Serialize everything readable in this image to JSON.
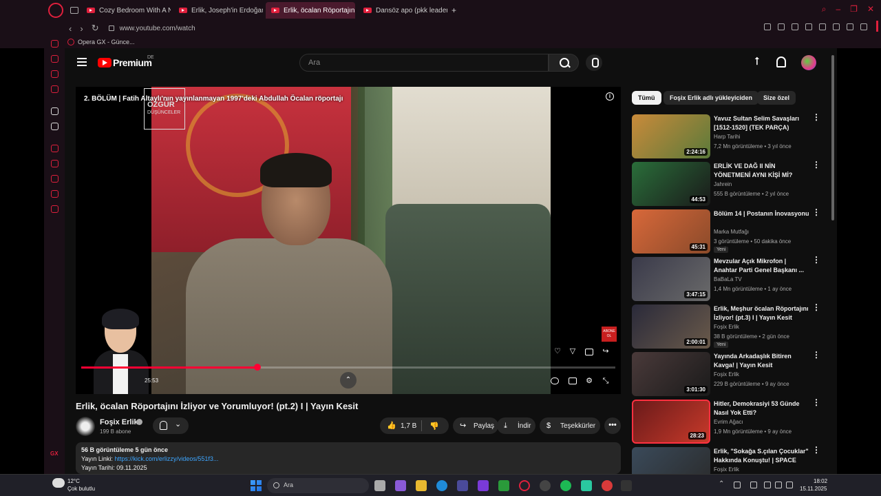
{
  "browser": {
    "tabs": [
      {
        "label": "Cozy Bedroom With A Ni",
        "active": false
      },
      {
        "label": "Erlik, Joseph'in Erdoğan",
        "active": false
      },
      {
        "label": "Erlik, öcalan Röportajını İz",
        "active": true
      },
      {
        "label": "Dansöz apo (pkk leader a",
        "active": false
      }
    ],
    "new_tab_label": "+",
    "url": "www.youtube.com/watch",
    "bookmark": "Opera GX - Günce...",
    "sidebar_gx": "GX",
    "accent": "#e0203d"
  },
  "youtube": {
    "logo_text": "Premium",
    "logo_region": "DE",
    "search_placeholder": "Ara",
    "upload_icon_glyph": "⭡"
  },
  "player": {
    "overlay_title": "2. BÖLÜM | Fatih Altaylı'nın yayınlanmayan 1997'deki Abdullah Öcalan röportajı",
    "channel_logo_line1": "ÖZGÜR",
    "channel_logo_line2": "DÜŞÜNCELER",
    "abone_badge": "ABONE OL",
    "time": "25:53",
    "progress": 0.33,
    "expand_glyph": "⌃",
    "info_glyph": "i"
  },
  "video": {
    "title": "Erlik, öcalan Röportajını İzliyor ve Yorumluyor! (pt.2) I | Yayın Kesit",
    "channel": "Foşix Erlik",
    "subscribers": "199 B abone",
    "likes": "1,7 B",
    "share_label": "Paylaş",
    "download_label": "İndir",
    "thanks_label": "Teşekkürler",
    "more_glyph": "•••",
    "bell_chevron": "⌄",
    "like_glyph": "👍",
    "dislike_glyph": "👎",
    "share_glyph": "↪",
    "download_glyph": "⤓",
    "thanks_glyph": "$"
  },
  "description": {
    "stats": "56 B görüntüleme  5 gün önce",
    "link_prefix": "Yayın Linki: ",
    "link": "https://kick.com/erlizzy/videos/551f3...",
    "date_line": "Yayın Tarihi: 09.11.2025"
  },
  "chips": [
    "Tümü",
    "Foşix Erlik adlı yükleyiciden",
    "Size özel"
  ],
  "recommendations": [
    {
      "title": "Yavuz Sultan Selim Savaşları [1512-1520] (TEK PARÇA)",
      "channel": "Harp Tarihi",
      "meta": "7,2 Mn görüntüleme • 3 yıl önce",
      "duration": "2:24:16",
      "badge": "",
      "thumb_color": "#c98a3a",
      "thumb_color2": "#5a7a3a"
    },
    {
      "title": "ERLİK VE DAĞ II NİN YÖNETMENİ AYNI KİŞİ Mİ?",
      "channel": "Jahrein",
      "meta": "555 B görüntüleme • 2 yıl önce",
      "duration": "44:53",
      "badge": "",
      "thumb_color": "#2a6e3a",
      "thumb_color2": "#1a1a1a"
    },
    {
      "title": "Bölüm 14 | Postanın İnovasyonu",
      "channel": "Marka Mutfağı",
      "meta": "3 görüntüleme • 50 dakika önce",
      "duration": "45:31",
      "badge": "Yeni",
      "thumb_color": "#d8683a",
      "thumb_color2": "#8a4a2a"
    },
    {
      "title": "Mevzular Açık Mikrofon | Anahtar Parti Genel Başkanı ...",
      "channel": "BaBaLa TV",
      "meta": "1,4 Mn görüntüleme • 1 ay önce",
      "duration": "3:47:15",
      "badge": "",
      "thumb_color": "#3a3a4a",
      "thumb_color2": "#6a6a6a"
    },
    {
      "title": "Erlik, Meşhur öcalan Röportajını İzliyor! (pt.3) I | Yayın Kesit",
      "channel": "Foşix Erlik",
      "meta": "38 B görüntüleme • 2 gün önce",
      "duration": "2:00:01",
      "badge": "Yeni",
      "thumb_color": "#2a2a3a",
      "thumb_color2": "#6a5a4a"
    },
    {
      "title": "Yayında Arkadaşlık Bitiren Kavga! | Yayın Kesit",
      "channel": "Foşix Erlik",
      "meta": "229 B görüntüleme • 9 ay önce",
      "duration": "3:01:30",
      "badge": "",
      "thumb_color": "#4a3a3a",
      "thumb_color2": "#1a1a1a"
    },
    {
      "title": "Hitler, Demokrasiyi 53 Günde Nasıl Yok Etti?",
      "channel": "Evrim Ağacı",
      "meta": "1,9 Mn görüntüleme • 9 ay önce",
      "duration": "28:23",
      "badge": "",
      "thumb_color": "#6a1a1a",
      "thumb_color2": "#c83a2a"
    },
    {
      "title": "Erlik, \"Sokağa S.çılan Çocuklar\" Hakkında Konuştu! | SPACE",
      "channel": "Foşix Erlik",
      "meta": "",
      "duration": "",
      "badge": "",
      "thumb_color": "#3a4a5a",
      "thumb_color2": "#2a2a2a"
    }
  ],
  "taskbar": {
    "weather_temp": "12°C",
    "weather_desc": "Çok bulutlu",
    "search_placeholder": "Ara",
    "time": "18:02",
    "date": "15.11.2025"
  }
}
